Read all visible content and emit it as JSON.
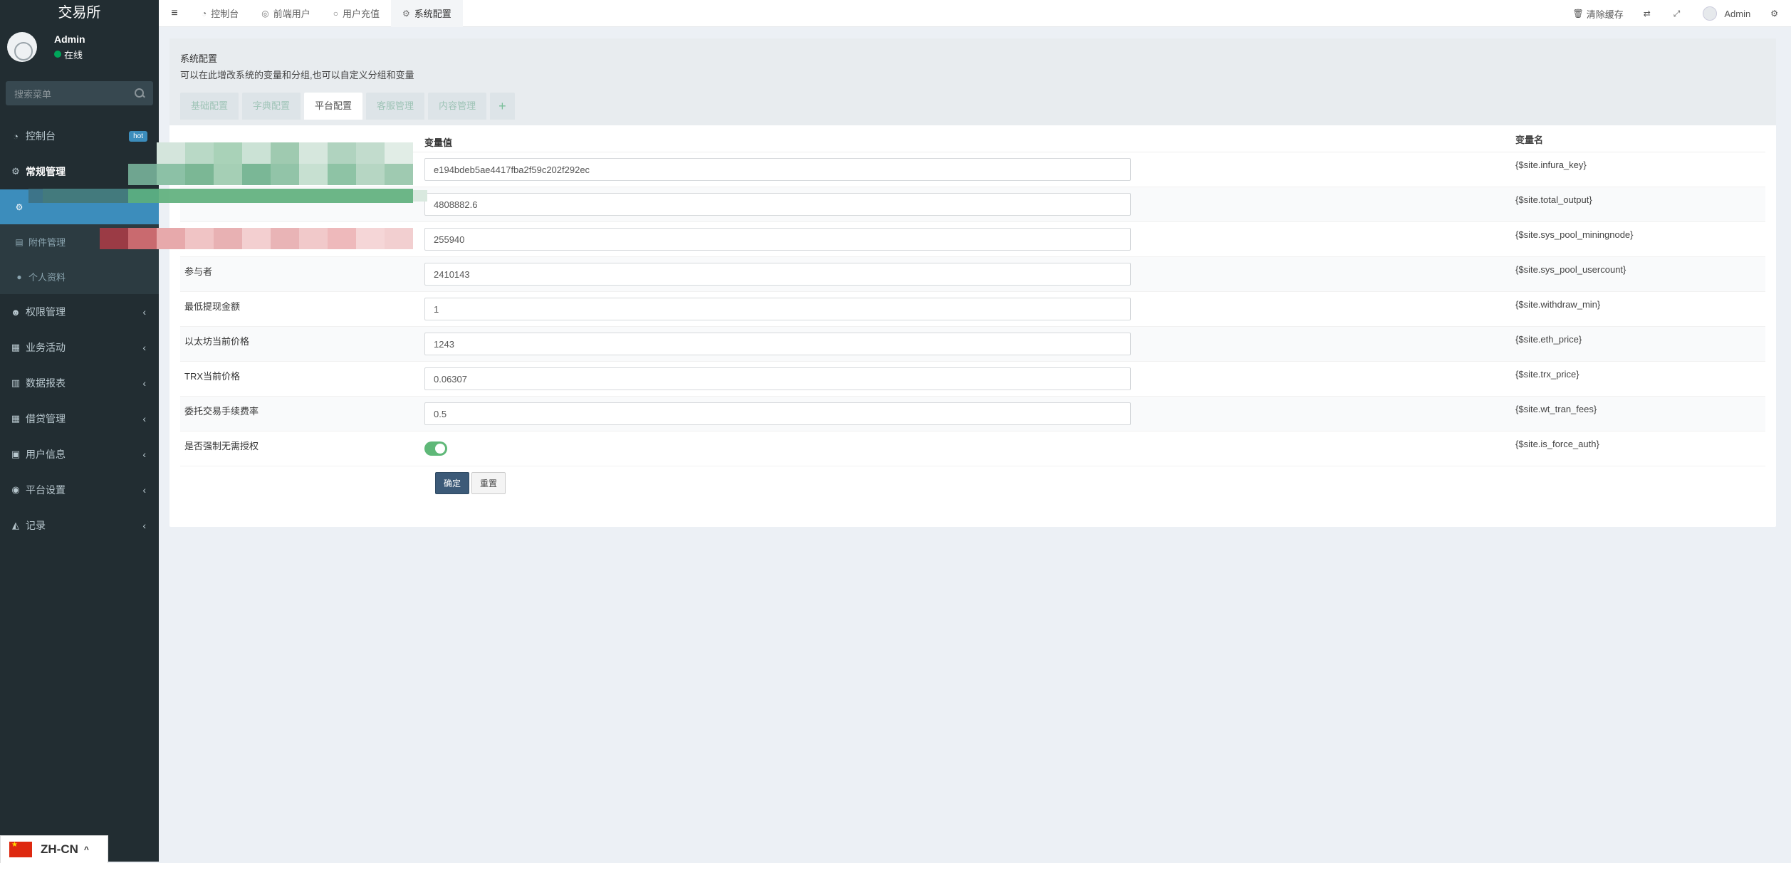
{
  "app": {
    "title": "交易所"
  },
  "user": {
    "name": "Admin",
    "status": "在线"
  },
  "sidebar": {
    "search_placeholder": "搜索菜单",
    "items": [
      {
        "label": "控制台",
        "icon": "dashboard-icon",
        "badge": "hot"
      },
      {
        "label": "常规管理",
        "icon": "cogs-icon"
      },
      {
        "label": "权限管理",
        "icon": "group-icon"
      },
      {
        "label": "业务活动",
        "icon": "list-icon"
      },
      {
        "label": "数据报表",
        "icon": "file-icon"
      },
      {
        "label": "借贷管理",
        "icon": "table-icon"
      },
      {
        "label": "用户信息",
        "icon": "id-card-icon"
      },
      {
        "label": "平台设置",
        "icon": "circle-icon"
      },
      {
        "label": "记录",
        "icon": "area-chart-icon"
      }
    ],
    "submenu": [
      {
        "label": "",
        "icon": "gear-icon",
        "active": true
      },
      {
        "label": "附件管理",
        "icon": "file-icon"
      },
      {
        "label": "个人资料",
        "icon": "user-icon"
      }
    ]
  },
  "topbar": {
    "tabs": [
      {
        "label": "控制台",
        "icon": "dashboard-icon"
      },
      {
        "label": "前端用户",
        "icon": "user-circle-icon"
      },
      {
        "label": "用户充值",
        "icon": "circle-outline-icon"
      },
      {
        "label": "系统配置",
        "icon": "gear-icon",
        "active": true
      }
    ],
    "clear_cache": "清除缓存",
    "admin": "Admin"
  },
  "panel": {
    "title": "系统配置",
    "description": "可以在此增改系统的变量和分组,也可以自定义分组和变量",
    "tabs": [
      "基础配置",
      "字典配置",
      "平台配置",
      "客服管理",
      "内容管理",
      "+"
    ],
    "active_tab": 2,
    "columns": {
      "title": "",
      "value": "变量值",
      "name": "变量名"
    },
    "rows": [
      {
        "title": "",
        "value": "e194bdeb5ae4417fba2f59c202f292ec",
        "var": "{$site.infura_key}"
      },
      {
        "title": "",
        "value": "4808882.6",
        "var": "{$site.total_output}"
      },
      {
        "title": "",
        "value": "255940",
        "var": "{$site.sys_pool_miningnode}"
      },
      {
        "title": "参与者",
        "value": "2410143",
        "var": "{$site.sys_pool_usercount}"
      },
      {
        "title": "最低提现金额",
        "value": "1",
        "var": "{$site.withdraw_min}"
      },
      {
        "title": "以太坊当前价格",
        "value": "1243",
        "var": "{$site.eth_price}"
      },
      {
        "title": "TRX当前价格",
        "value": "0.06307",
        "var": "{$site.trx_price}"
      },
      {
        "title": "委托交易手续费率",
        "value": "0.5",
        "var": "{$site.wt_tran_fees}"
      },
      {
        "title": "是否强制无需授权",
        "toggle": true,
        "var": "{$site.is_force_auth}"
      }
    ],
    "buttons": {
      "confirm": "确定",
      "reset": "重置"
    }
  },
  "language": {
    "label": "ZH-CN"
  },
  "colors": {
    "sidebar": "#222d32",
    "accent": "#3c8dbc",
    "toggle_on": "#5fb878",
    "confirm": "#3c5a78"
  }
}
